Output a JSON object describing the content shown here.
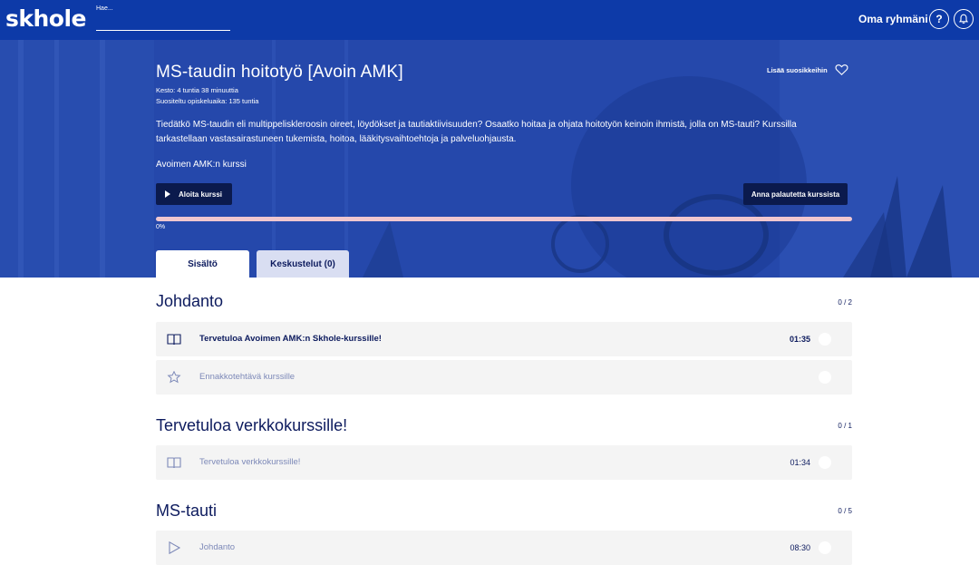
{
  "header": {
    "logo": "skhole",
    "search_placeholder": "Hae...",
    "group_label": "Oma ryhmäni",
    "help_label": "?"
  },
  "course": {
    "title": "MS-taudin hoitotyö [Avoin AMK]",
    "duration": "Kesto: 4 tuntia 38 minuuttia",
    "recommended_time": "Suositeltu opiskeluaika: 135 tuntia",
    "description": "Tiedätkö MS-taudin eli multippeliskleroosin oireet, löydökset ja tautiaktiivisuuden? Osaatko hoitaa ja ohjata hoitotyön keinoin ihmistä, jolla on MS-tauti? Kurssilla tarkastellaan vastasairastuneen tukemista, hoitoa, lääkitysvaihtoehtoja ja palveluohjausta.",
    "provider_note": "Avoimen AMK:n kurssi",
    "favorite_label": "Lisää suosikkeihin",
    "start_label": "Aloita kurssi",
    "feedback_label": "Anna palautetta kurssista",
    "progress_text": "0%",
    "progress_value": 0
  },
  "tabs": [
    {
      "label": "Sisältö",
      "active": true
    },
    {
      "label": "Keskustelut (0)",
      "active": false
    }
  ],
  "sections": [
    {
      "title": "Johdanto",
      "count": "0 / 2",
      "items": [
        {
          "title": "Tervetuloa Avoimen AMK:n Skhole-kurssille!",
          "time": "01:35",
          "icon": "book-icon"
        },
        {
          "title": "Ennakkotehtävä kurssille",
          "time": "",
          "icon": "star-icon"
        }
      ]
    },
    {
      "title": "Tervetuloa verkkokurssille!",
      "count": "0 / 1",
      "items": [
        {
          "title": "Tervetuloa verkkokurssille!",
          "time": "01:34",
          "icon": "book-icon"
        }
      ]
    },
    {
      "title": "MS-tauti",
      "count": "0 / 5",
      "items": [
        {
          "title": "Johdanto",
          "time": "08:30",
          "icon": "play-icon"
        }
      ]
    }
  ],
  "colors": {
    "navbar": "#0d3aa8",
    "hero": "#2447a8",
    "dark_button": "#0b1a4d",
    "progress": "#f0c7cf"
  }
}
